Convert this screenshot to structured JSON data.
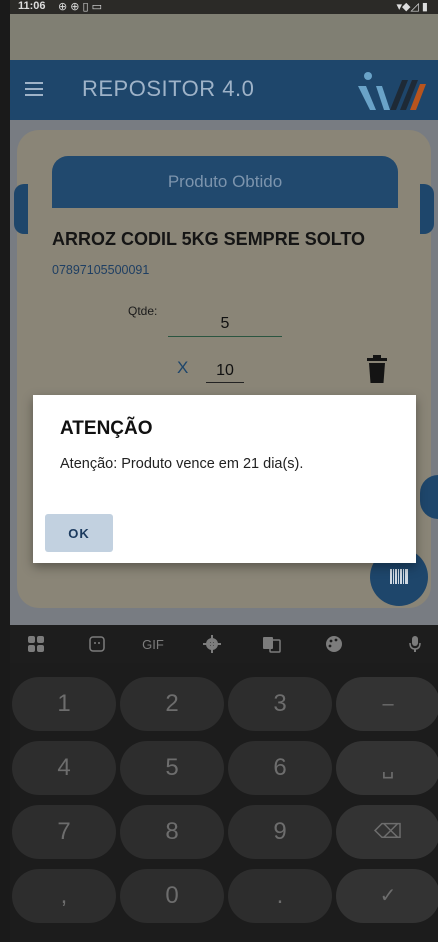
{
  "status": {
    "time": "11:06",
    "left_icons": "⊕ ⊕ ▯ ▭",
    "right_icons": "▾◆◿ ▮"
  },
  "app": {
    "title": "REPOSITOR 4.0"
  },
  "card": {
    "header": "Produto Obtido",
    "product_name": "ARROZ CODIL 5KG SEMPRE SOLTO",
    "barcode": "07897105500091",
    "qtde_label": "Qtde:",
    "qtde_value": "5",
    "times_symbol": "X",
    "multiplier": "10"
  },
  "dialog": {
    "title": "ATENÇÃO",
    "message": "Atenção: Produto vence em 21 dia(s).",
    "ok_label": "OK"
  },
  "keyboard": {
    "toolbar": [
      "apps-icon",
      "sticker-icon",
      "GIF",
      "gear-icon",
      "translate-icon",
      "palette-icon",
      "mic-icon"
    ],
    "gif_label": "GIF",
    "rows": [
      [
        "1",
        "2",
        "3",
        "–"
      ],
      [
        "4",
        "5",
        "6",
        "␣"
      ],
      [
        "7",
        "8",
        "9",
        "⌫"
      ],
      [
        ",",
        "0",
        ".",
        "✓"
      ]
    ]
  },
  "colors": {
    "primary": "#1e466b",
    "dialog_button": "#c2d1e0"
  }
}
